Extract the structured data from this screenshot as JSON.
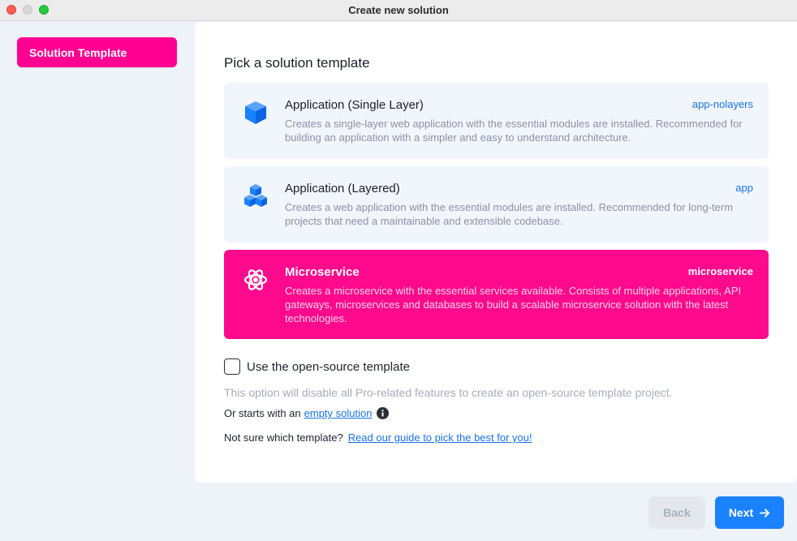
{
  "window": {
    "title": "Create new solution"
  },
  "sidebar": {
    "items": [
      {
        "label": "Solution Template",
        "active": true
      }
    ]
  },
  "main": {
    "title": "Pick a solution template",
    "templates": [
      {
        "title": "Application (Single Layer)",
        "tag": "app-nolayers",
        "description": "Creates a single-layer web application with the essential modules are installed. Recommended for building an application with a simpler and easy to understand architecture.",
        "icon": "cube-icon",
        "selected": false
      },
      {
        "title": "Application (Layered)",
        "tag": "app",
        "description": "Creates a web application with the essential modules are installed. Recommended for long-term projects that need a maintainable and extensible codebase.",
        "icon": "cubes-icon",
        "selected": false
      },
      {
        "title": "Microservice",
        "tag": "microservice",
        "description": "Creates a microservice with the essential services available. Consists of multiple applications, API gateways, microservices and databases to build a scalable microservice solution with the latest technologies.",
        "icon": "atom-icon",
        "selected": true
      }
    ],
    "open_source": {
      "label": "Use the open-source template",
      "checked": false,
      "hint": "This option will disable all Pro-related features to create an open-source template project."
    },
    "empty": {
      "prefix": "Or starts with an",
      "link": "empty solution"
    },
    "guide": {
      "prefix": "Not sure which template?",
      "link": "Read our guide to pick the best for you!"
    }
  },
  "footer": {
    "back_label": "Back",
    "next_label": "Next"
  },
  "colors": {
    "accent": "#ff0a8c",
    "primary": "#1a82ff",
    "link": "#1a73e8"
  }
}
